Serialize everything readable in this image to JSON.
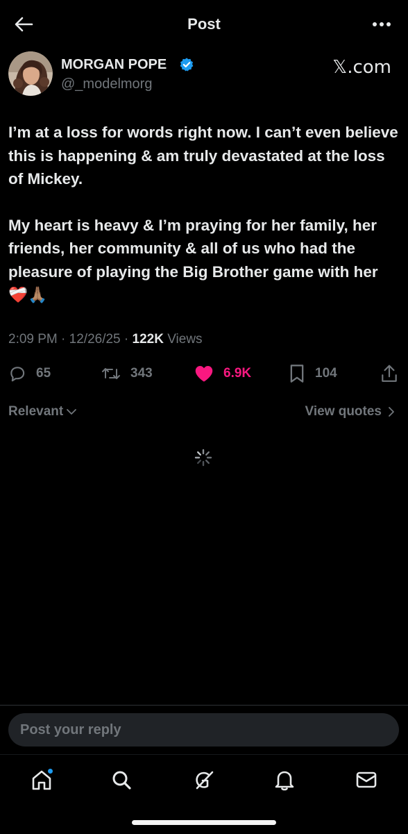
{
  "header": {
    "title": "Post"
  },
  "author": {
    "display_name": "MORGAN POPE",
    "handle": "@_modelmorg",
    "verified": true,
    "source_label": "𝕏.com"
  },
  "post": {
    "paragraphs": [
      "I’m at a loss for words right now. I can’t even believe this is happening & am truly devastated at the loss of Mickey.",
      "My heart is heavy & I’m praying for her family, her friends, her community & all of us who had the pleasure of playing the Big Brother game with her ❤️‍🩹🙏🏽"
    ],
    "time": "2:09 PM",
    "date": "12/26/25",
    "views_count": "122K",
    "views_label": "Views"
  },
  "actions": {
    "replies": "65",
    "reposts": "343",
    "likes": "6.9K",
    "bookmarks": "104"
  },
  "filters": {
    "sort_label": "Relevant",
    "quotes_label": "View quotes"
  },
  "reply": {
    "placeholder": "Post your reply"
  },
  "colors": {
    "background": "#000000",
    "text_primary": "#e7e9ea",
    "text_secondary": "#71767b",
    "like_pink": "#f91880",
    "verified_blue": "#1d9bf0",
    "reply_field": "#202327"
  },
  "icons": {
    "back": "arrow-left-icon",
    "more": "more-horizontal-icon",
    "reply": "reply-bubble-icon",
    "repost": "repost-icon",
    "like": "heart-filled-icon",
    "bookmark": "bookmark-icon",
    "share": "share-icon",
    "home": "home-icon",
    "search": "search-icon",
    "grok": "grok-icon",
    "notifications": "bell-icon",
    "messages": "envelope-icon"
  }
}
